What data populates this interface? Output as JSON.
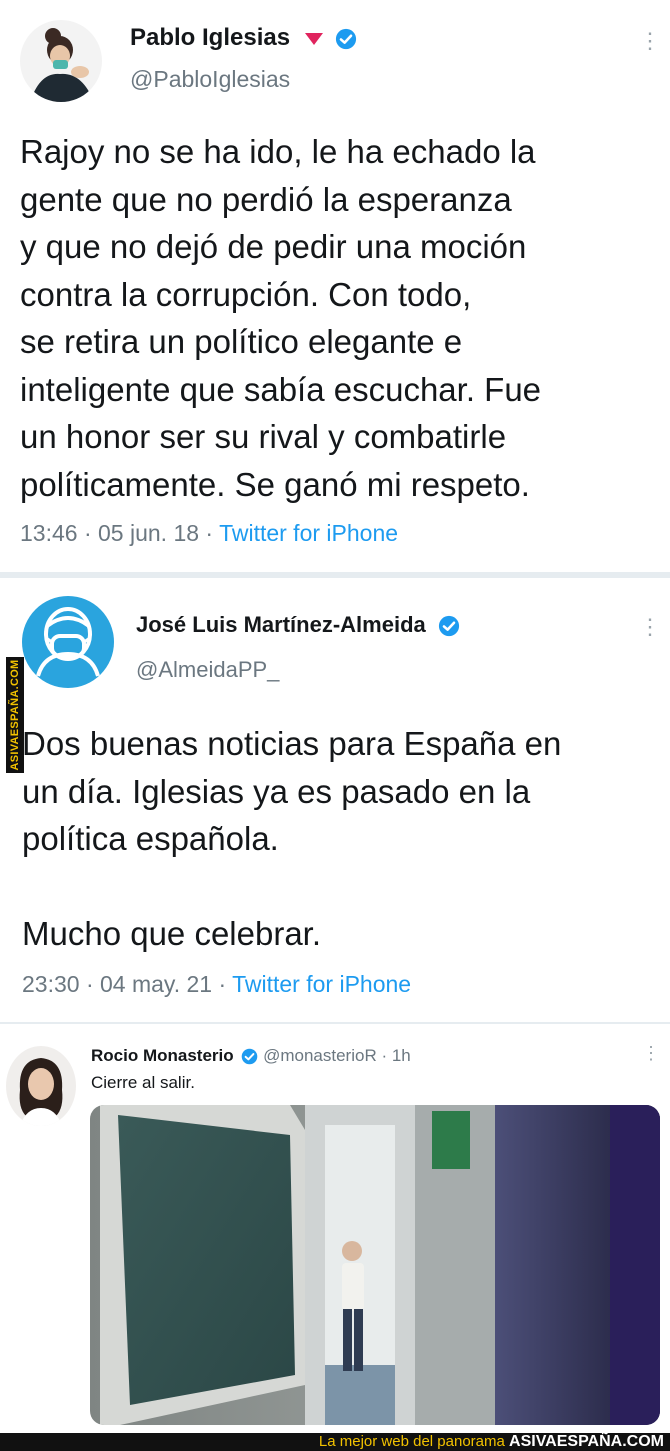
{
  "tweet1": {
    "name": "Pablo Iglesias",
    "handle": "@PabloIglesias",
    "text": "Rajoy no se ha ido, le ha echado la\ngente que no perdió la esperanza\ny que no dejó de pedir una moción\ncontra la corrupción. Con todo,\nse retira un político elegante e\ninteligente que sabía escuchar. Fue\nun honor ser su rival y combatirle\npolíticamente. Se ganó mi respeto.",
    "time": "13:46 · 05 jun. 18 ·",
    "source": "Twitter for iPhone"
  },
  "tweet2": {
    "name": "José Luis Martínez-Almeida",
    "handle": "@AlmeidaPP_",
    "text": "Dos buenas noticias para España en\nun día. Iglesias ya es pasado en la\npolítica española.\n\nMucho que celebrar.",
    "time": "23:30 · 04 may. 21 ·",
    "source": "Twitter for iPhone"
  },
  "tweet3": {
    "name": "Rocio Monasterio",
    "handle_time": "@monasterioR · 1h",
    "text": "Cierre al salir."
  },
  "watermark": {
    "side": "ASIVAESPAÑA.COM",
    "footer_text": "La mejor web del panorama",
    "footer_brand": "ASIVAESPAÑA.COM"
  },
  "colors": {
    "verified": "#1d9bf0",
    "link": "#1d9bf0",
    "footer_bg": "#111111",
    "footer_text": "#f2c200"
  }
}
